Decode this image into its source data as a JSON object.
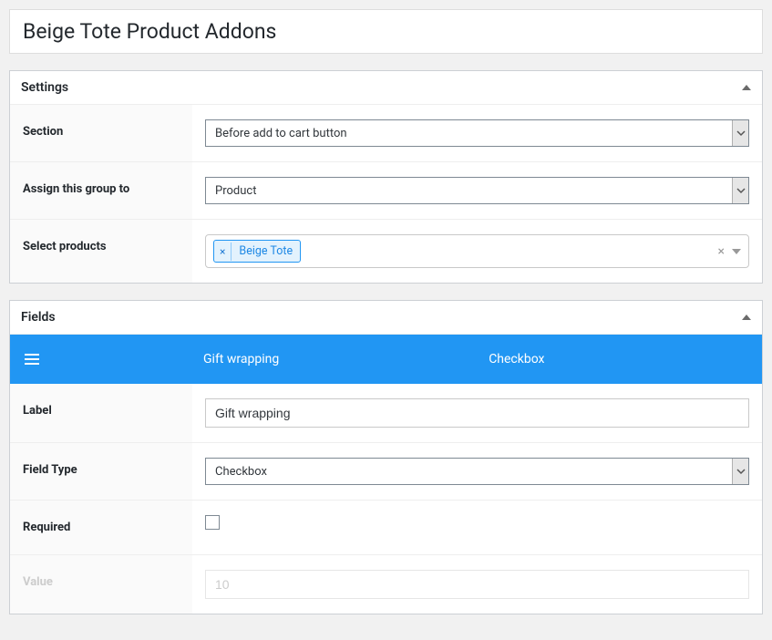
{
  "title": "Beige Tote Product Addons",
  "settings": {
    "heading": "Settings",
    "rows": {
      "section": {
        "label": "Section",
        "value": "Before add to cart button"
      },
      "assign": {
        "label": "Assign this group to",
        "value": "Product"
      },
      "selectp": {
        "label": "Select products",
        "tag": "Beige Tote"
      }
    }
  },
  "fields": {
    "heading": "Fields",
    "bar": {
      "name": "Gift wrapping",
      "type": "Checkbox"
    },
    "rows": {
      "label": {
        "label": "Label",
        "value": "Gift wrapping"
      },
      "fieldtype": {
        "label": "Field Type",
        "value": "Checkbox"
      },
      "required": {
        "label": "Required",
        "checked": false
      },
      "value": {
        "label": "Value",
        "value": "10"
      }
    }
  }
}
